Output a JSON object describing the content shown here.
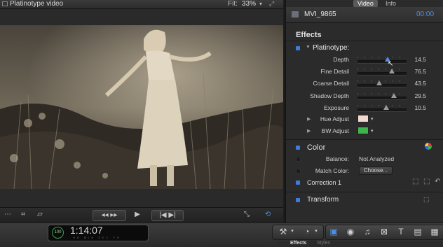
{
  "viewer": {
    "title": "Platinotype video",
    "fit_label": "Fit:",
    "fit_value": "33%"
  },
  "inspector": {
    "tabs": [
      {
        "label": "Video",
        "active": true
      },
      {
        "label": "Info",
        "active": false
      }
    ],
    "clip_name": "MVI_9865",
    "clip_timecode": "00:00",
    "effects_title": "Effects",
    "effect_name": "Platinotype:",
    "params": [
      {
        "label": "Depth",
        "value": "14.5",
        "level": 0.62,
        "active": true
      },
      {
        "label": "Fine Detail",
        "value": "76.5",
        "level": 0.7,
        "active": false
      },
      {
        "label": "Coarse Detail",
        "value": "43.5",
        "level": 0.44,
        "active": false
      },
      {
        "label": "Shadow Depth",
        "value": "29.5",
        "level": 0.74,
        "active": false
      },
      {
        "label": "Exposure",
        "value": "10.5",
        "level": 0.58,
        "active": false
      }
    ],
    "hue_adjust_label": "Hue Adjust",
    "hue_adjust_color": "#f1d9cf",
    "bw_adjust_label": "BW Adjust",
    "bw_adjust_color": "#3db54a",
    "color_title": "Color",
    "balance_label": "Balance:",
    "balance_value": "Not Analyzed",
    "match_color_label": "Match Color:",
    "choose_label": "Choose...",
    "correction_label": "Correction 1",
    "transform_title": "Transform"
  },
  "toolbar": {
    "timecode_percent": "100",
    "timecode": "1:14:07",
    "timecode_units": "HR MIN SEC FR"
  },
  "bottom_tabs": [
    {
      "label": "Effects",
      "active": true
    },
    {
      "label": "Styles",
      "active": false
    }
  ],
  "colors": {
    "accent": "#3d7bdc",
    "timecode_blue": "#4a90e2"
  }
}
